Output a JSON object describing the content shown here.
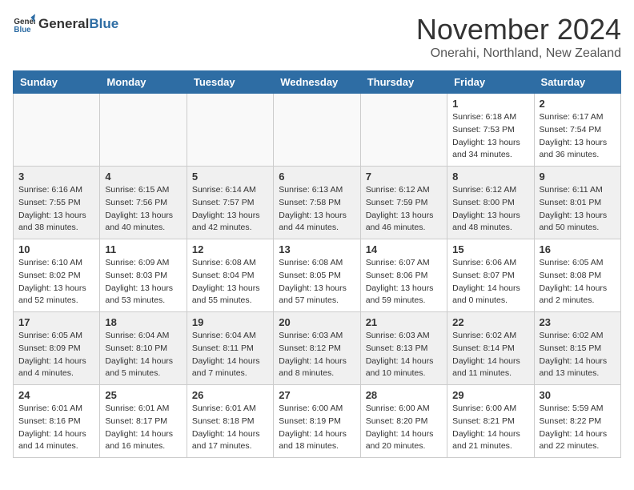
{
  "logo": {
    "general": "General",
    "blue": "Blue"
  },
  "title": "November 2024",
  "subtitle": "Onerahi, Northland, New Zealand",
  "weekdays": [
    "Sunday",
    "Monday",
    "Tuesday",
    "Wednesday",
    "Thursday",
    "Friday",
    "Saturday"
  ],
  "weeks": [
    [
      {
        "day": "",
        "info": ""
      },
      {
        "day": "",
        "info": ""
      },
      {
        "day": "",
        "info": ""
      },
      {
        "day": "",
        "info": ""
      },
      {
        "day": "",
        "info": ""
      },
      {
        "day": "1",
        "info": "Sunrise: 6:18 AM\nSunset: 7:53 PM\nDaylight: 13 hours\nand 34 minutes."
      },
      {
        "day": "2",
        "info": "Sunrise: 6:17 AM\nSunset: 7:54 PM\nDaylight: 13 hours\nand 36 minutes."
      }
    ],
    [
      {
        "day": "3",
        "info": "Sunrise: 6:16 AM\nSunset: 7:55 PM\nDaylight: 13 hours\nand 38 minutes."
      },
      {
        "day": "4",
        "info": "Sunrise: 6:15 AM\nSunset: 7:56 PM\nDaylight: 13 hours\nand 40 minutes."
      },
      {
        "day": "5",
        "info": "Sunrise: 6:14 AM\nSunset: 7:57 PM\nDaylight: 13 hours\nand 42 minutes."
      },
      {
        "day": "6",
        "info": "Sunrise: 6:13 AM\nSunset: 7:58 PM\nDaylight: 13 hours\nand 44 minutes."
      },
      {
        "day": "7",
        "info": "Sunrise: 6:12 AM\nSunset: 7:59 PM\nDaylight: 13 hours\nand 46 minutes."
      },
      {
        "day": "8",
        "info": "Sunrise: 6:12 AM\nSunset: 8:00 PM\nDaylight: 13 hours\nand 48 minutes."
      },
      {
        "day": "9",
        "info": "Sunrise: 6:11 AM\nSunset: 8:01 PM\nDaylight: 13 hours\nand 50 minutes."
      }
    ],
    [
      {
        "day": "10",
        "info": "Sunrise: 6:10 AM\nSunset: 8:02 PM\nDaylight: 13 hours\nand 52 minutes."
      },
      {
        "day": "11",
        "info": "Sunrise: 6:09 AM\nSunset: 8:03 PM\nDaylight: 13 hours\nand 53 minutes."
      },
      {
        "day": "12",
        "info": "Sunrise: 6:08 AM\nSunset: 8:04 PM\nDaylight: 13 hours\nand 55 minutes."
      },
      {
        "day": "13",
        "info": "Sunrise: 6:08 AM\nSunset: 8:05 PM\nDaylight: 13 hours\nand 57 minutes."
      },
      {
        "day": "14",
        "info": "Sunrise: 6:07 AM\nSunset: 8:06 PM\nDaylight: 13 hours\nand 59 minutes."
      },
      {
        "day": "15",
        "info": "Sunrise: 6:06 AM\nSunset: 8:07 PM\nDaylight: 14 hours\nand 0 minutes."
      },
      {
        "day": "16",
        "info": "Sunrise: 6:05 AM\nSunset: 8:08 PM\nDaylight: 14 hours\nand 2 minutes."
      }
    ],
    [
      {
        "day": "17",
        "info": "Sunrise: 6:05 AM\nSunset: 8:09 PM\nDaylight: 14 hours\nand 4 minutes."
      },
      {
        "day": "18",
        "info": "Sunrise: 6:04 AM\nSunset: 8:10 PM\nDaylight: 14 hours\nand 5 minutes."
      },
      {
        "day": "19",
        "info": "Sunrise: 6:04 AM\nSunset: 8:11 PM\nDaylight: 14 hours\nand 7 minutes."
      },
      {
        "day": "20",
        "info": "Sunrise: 6:03 AM\nSunset: 8:12 PM\nDaylight: 14 hours\nand 8 minutes."
      },
      {
        "day": "21",
        "info": "Sunrise: 6:03 AM\nSunset: 8:13 PM\nDaylight: 14 hours\nand 10 minutes."
      },
      {
        "day": "22",
        "info": "Sunrise: 6:02 AM\nSunset: 8:14 PM\nDaylight: 14 hours\nand 11 minutes."
      },
      {
        "day": "23",
        "info": "Sunrise: 6:02 AM\nSunset: 8:15 PM\nDaylight: 14 hours\nand 13 minutes."
      }
    ],
    [
      {
        "day": "24",
        "info": "Sunrise: 6:01 AM\nSunset: 8:16 PM\nDaylight: 14 hours\nand 14 minutes."
      },
      {
        "day": "25",
        "info": "Sunrise: 6:01 AM\nSunset: 8:17 PM\nDaylight: 14 hours\nand 16 minutes."
      },
      {
        "day": "26",
        "info": "Sunrise: 6:01 AM\nSunset: 8:18 PM\nDaylight: 14 hours\nand 17 minutes."
      },
      {
        "day": "27",
        "info": "Sunrise: 6:00 AM\nSunset: 8:19 PM\nDaylight: 14 hours\nand 18 minutes."
      },
      {
        "day": "28",
        "info": "Sunrise: 6:00 AM\nSunset: 8:20 PM\nDaylight: 14 hours\nand 20 minutes."
      },
      {
        "day": "29",
        "info": "Sunrise: 6:00 AM\nSunset: 8:21 PM\nDaylight: 14 hours\nand 21 minutes."
      },
      {
        "day": "30",
        "info": "Sunrise: 5:59 AM\nSunset: 8:22 PM\nDaylight: 14 hours\nand 22 minutes."
      }
    ]
  ]
}
